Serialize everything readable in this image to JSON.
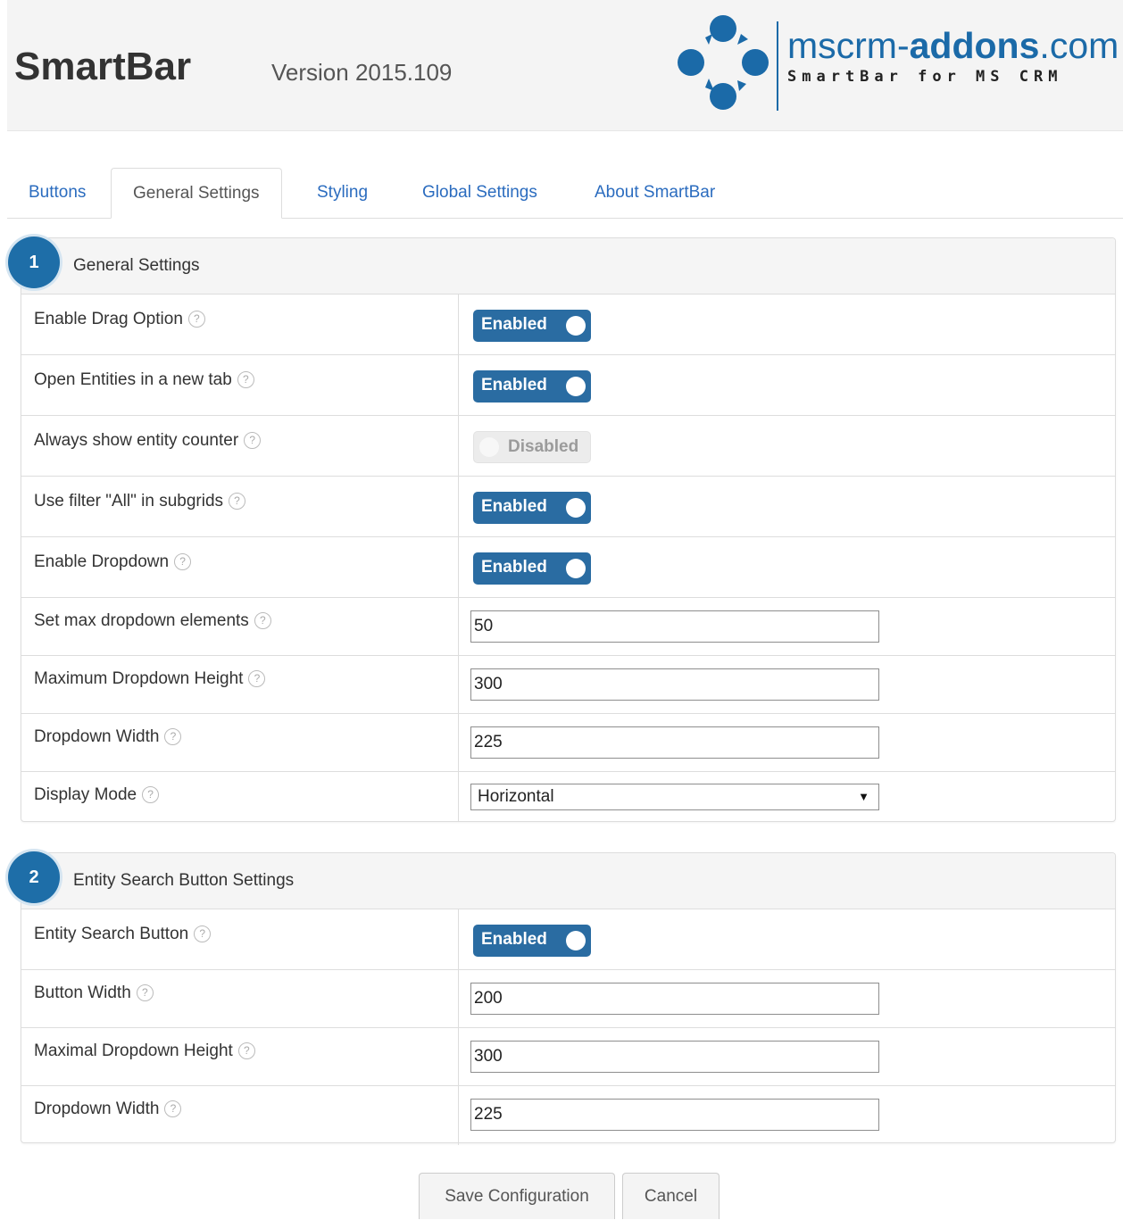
{
  "header": {
    "title": "SmartBar",
    "version": "Version 2015.109",
    "logo_name_a": "mscrm-",
    "logo_name_b": "addons",
    "logo_name_c": ".com",
    "logo_sub": "SmartBar for MS CRM"
  },
  "tabs": [
    {
      "label": "Buttons",
      "active": false
    },
    {
      "label": "General Settings",
      "active": true
    },
    {
      "label": "Styling",
      "active": false
    },
    {
      "label": "Global Settings",
      "active": false
    },
    {
      "label": "About SmartBar",
      "active": false
    }
  ],
  "panel1": {
    "badge": "1",
    "title": "General Settings",
    "rows": [
      {
        "label": "Enable Drag Option",
        "type": "toggle",
        "value": "Enabled",
        "on": true
      },
      {
        "label": "Open Entities in a new tab",
        "type": "toggle",
        "value": "Enabled",
        "on": true
      },
      {
        "label": "Always show entity counter",
        "type": "toggle",
        "value": "Disabled",
        "on": false
      },
      {
        "label": "Use filter \"All\" in subgrids",
        "type": "toggle",
        "value": "Enabled",
        "on": true
      },
      {
        "label": "Enable Dropdown",
        "type": "toggle",
        "value": "Enabled",
        "on": true
      },
      {
        "label": "Set max dropdown elements",
        "type": "input",
        "value": "50"
      },
      {
        "label": "Maximum Dropdown Height",
        "type": "input",
        "value": "300"
      },
      {
        "label": "Dropdown Width",
        "type": "input",
        "value": "225"
      },
      {
        "label": "Display Mode",
        "type": "select",
        "value": "Horizontal"
      }
    ]
  },
  "panel2": {
    "badge": "2",
    "title": "Entity Search Button Settings",
    "rows": [
      {
        "label": "Entity Search Button",
        "type": "toggle",
        "value": "Enabled",
        "on": true
      },
      {
        "label": "Button Width",
        "type": "input",
        "value": "200"
      },
      {
        "label": "Maximal Dropdown Height",
        "type": "input",
        "value": "300"
      },
      {
        "label": "Dropdown Width",
        "type": "input",
        "value": "225"
      }
    ]
  },
  "actions": {
    "save_label": "Save Configuration",
    "cancel_label": "Cancel"
  },
  "help_glyph": "?",
  "caret_glyph": "▼",
  "colors": {
    "accent": "#2a6ca2",
    "link": "#2b6cbf",
    "badge": "#1e6ea8"
  }
}
